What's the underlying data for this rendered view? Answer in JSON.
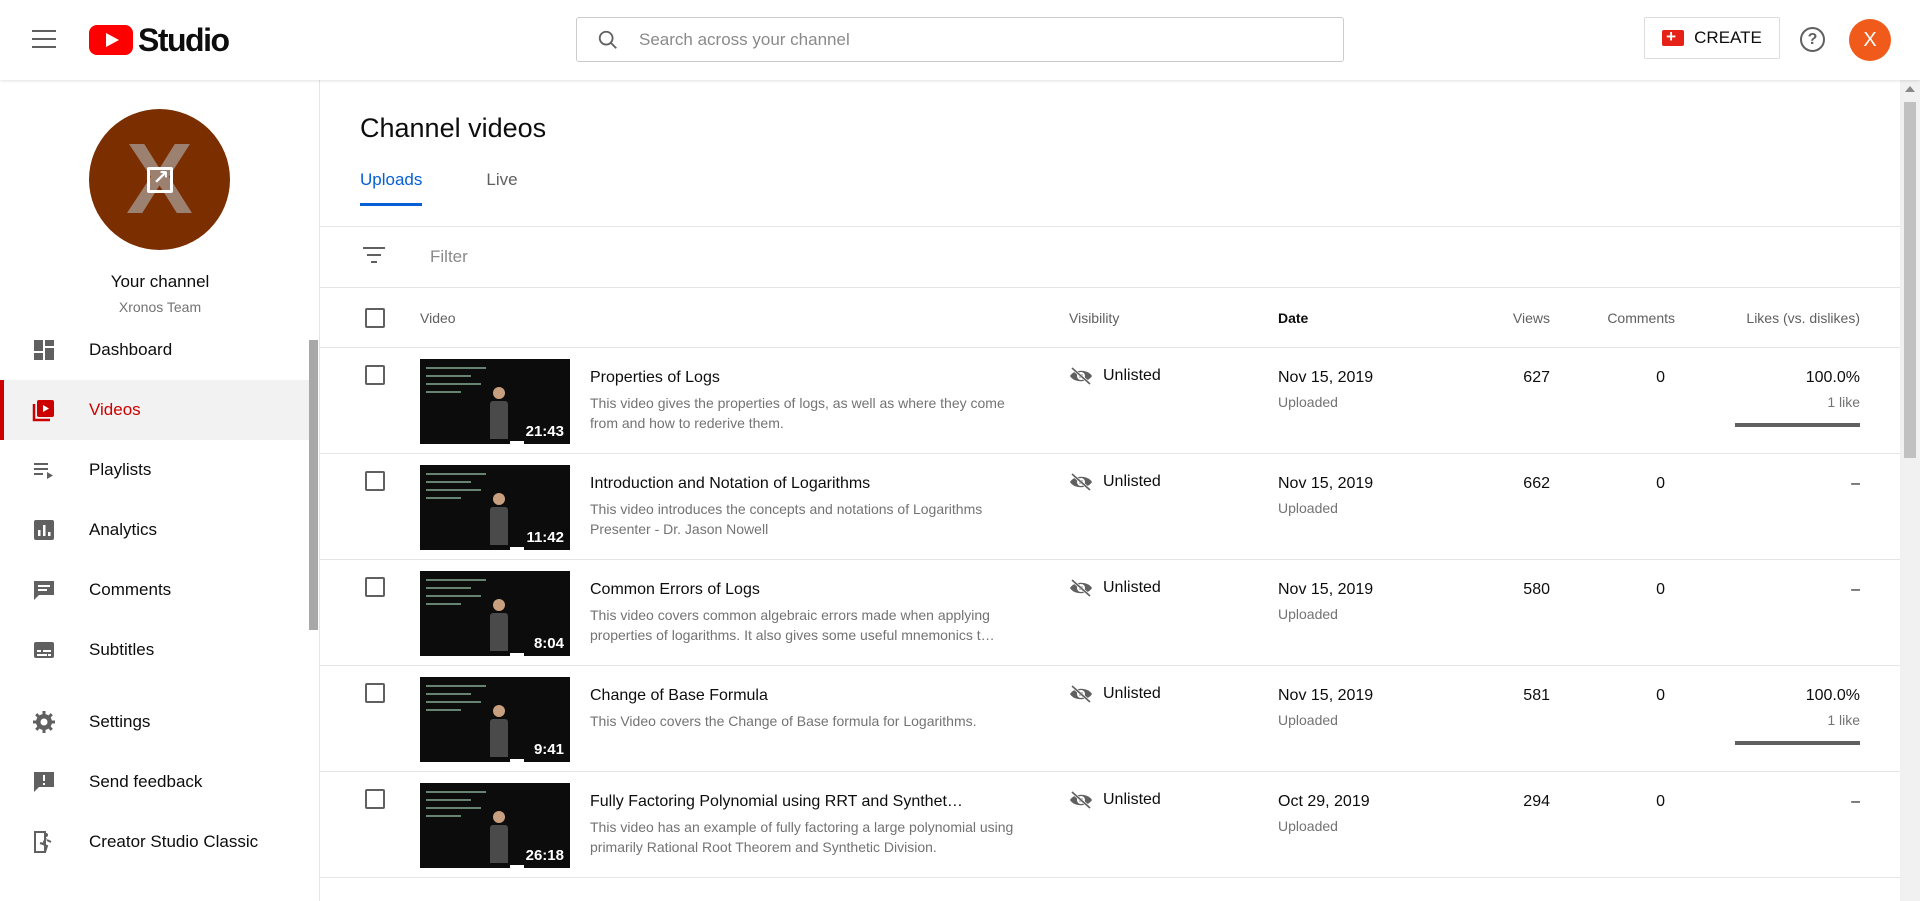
{
  "header": {
    "logo_text": "Studio",
    "search_placeholder": "Search across your channel",
    "create_label": "CREATE",
    "help_label": "?",
    "avatar_letter": "X"
  },
  "sidebar": {
    "your_channel": "Your channel",
    "channel_name": "Xronos Team",
    "avatar_letter": "X",
    "items": [
      {
        "label": "Dashboard",
        "icon": "dashboard-icon",
        "active": false
      },
      {
        "label": "Videos",
        "icon": "videos-icon",
        "active": true
      },
      {
        "label": "Playlists",
        "icon": "playlists-icon",
        "active": false
      },
      {
        "label": "Analytics",
        "icon": "analytics-icon",
        "active": false
      },
      {
        "label": "Comments",
        "icon": "comments-icon",
        "active": false
      },
      {
        "label": "Subtitles",
        "icon": "subtitles-icon",
        "active": false
      },
      {
        "label": "Settings",
        "icon": "settings-icon",
        "active": false
      },
      {
        "label": "Send feedback",
        "icon": "feedback-icon",
        "active": false
      },
      {
        "label": "Creator Studio Classic",
        "icon": "classic-studio-icon",
        "active": false
      }
    ]
  },
  "main": {
    "title": "Channel videos",
    "tabs": [
      {
        "label": "Uploads",
        "active": true
      },
      {
        "label": "Live",
        "active": false
      }
    ],
    "filter_placeholder": "Filter",
    "columns": {
      "video": "Video",
      "visibility": "Visibility",
      "date": "Date",
      "views": "Views",
      "comments": "Comments",
      "likes": "Likes (vs. dislikes)"
    },
    "rows": [
      {
        "title": "Properties of Logs",
        "description": "This video gives the properties of logs, as well as where they come from and how to rederive them.",
        "duration": "21:43",
        "visibility": "Unlisted",
        "date": "Nov 15, 2019",
        "status": "Uploaded",
        "views": "627",
        "comments": "0",
        "likes": "100.0%",
        "likes_count": "1 like",
        "like_ratio": 1.0
      },
      {
        "title": "Introduction and Notation of Logarithms",
        "description": "This video introduces the concepts and notations of Logarithms Presenter - Dr. Jason Nowell",
        "duration": "11:42",
        "visibility": "Unlisted",
        "date": "Nov 15, 2019",
        "status": "Uploaded",
        "views": "662",
        "comments": "0",
        "likes": "–",
        "likes_count": "",
        "like_ratio": null
      },
      {
        "title": "Common Errors of Logs",
        "description": "This video covers common algebraic errors made when applying properties of logarithms. It also gives some useful mnemonics t…",
        "duration": "8:04",
        "visibility": "Unlisted",
        "date": "Nov 15, 2019",
        "status": "Uploaded",
        "views": "580",
        "comments": "0",
        "likes": "–",
        "likes_count": "",
        "like_ratio": null
      },
      {
        "title": "Change of Base Formula",
        "description": "This Video covers the Change of Base formula for Logarithms.",
        "duration": "9:41",
        "visibility": "Unlisted",
        "date": "Nov 15, 2019",
        "status": "Uploaded",
        "views": "581",
        "comments": "0",
        "likes": "100.0%",
        "likes_count": "1 like",
        "like_ratio": 1.0
      },
      {
        "title": "Fully Factoring Polynomial using RRT and Synthet…",
        "description": "This video has an example of fully factoring a large polynomial using primarily Rational Root Theorem and Synthetic Division.",
        "duration": "26:18",
        "visibility": "Unlisted",
        "date": "Oct 29, 2019",
        "status": "Uploaded",
        "views": "294",
        "comments": "0",
        "likes": "–",
        "likes_count": "",
        "like_ratio": null
      }
    ]
  }
}
